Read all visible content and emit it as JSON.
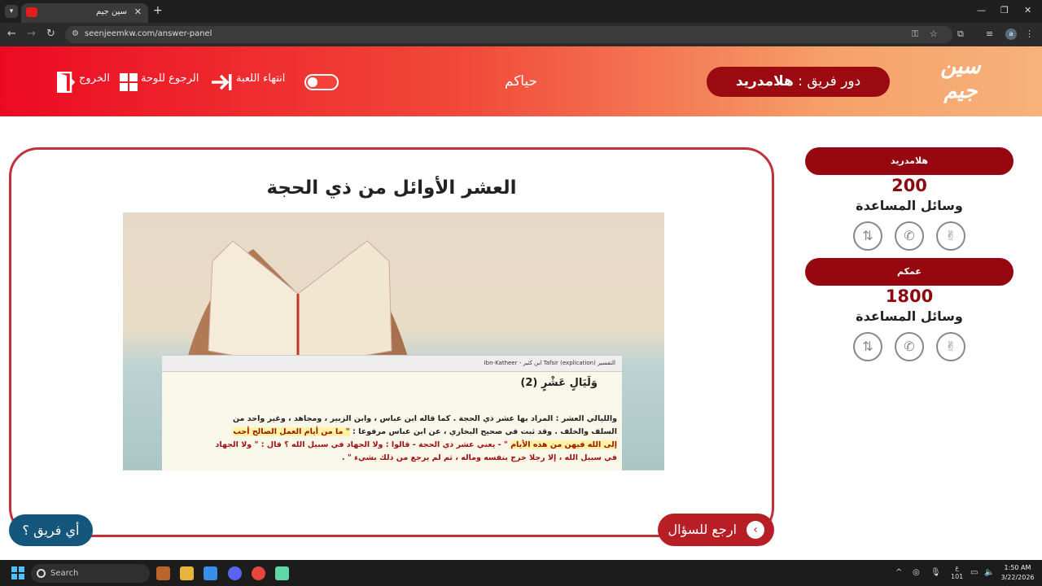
{
  "browser": {
    "tab_title": "سين جيم",
    "url": "seenjeemkw.com/answer-panel",
    "profile_initial": "a"
  },
  "header": {
    "logo_line1": "سين",
    "logo_line2": "جيم",
    "team_turn_label": "دور فريق : ",
    "team_turn_name": "هلامدريد",
    "greeting": "حياكم",
    "end_game": "انتهاء اللعبة",
    "back_to_board": "الرجوع للوحة",
    "exit": "الخروج"
  },
  "teams": [
    {
      "name": "هلامدريد",
      "score": "200",
      "aids_label": "وسائل المساعدة"
    },
    {
      "name": "عمكم",
      "score": "1800",
      "aids_label": "وسائل المساعدة"
    }
  ],
  "question": {
    "title": "العشر الأوائل من ذي الحجة",
    "tafsir_bar": "التفسير Tafsir (explication) ابن كثير - Ibn-Katheer",
    "tafsir_heading": "وَلَيَالٍ عَشْرٍ (2)",
    "tafsir_line1": "والليالي العشر : المراد بها عشر ذي الحجة . كما قاله ابن عباس ، وابن الزبير ، ومجاهد ، وغير واحد من",
    "tafsir_line2a": "السلف والخلف . وقد ثبت في صحيح البخاري ، عن ابن عباس مرفوعا : ",
    "tafsir_line2b": "\" ما من أيام العمل الصالح أحب",
    "tafsir_line3a": "إلى الله فيهن من هذه الأيام",
    "tafsir_line3b": " \" - يعني عشر ذي الحجة - قالوا : ولا الجهاد في سبيل الله ؟ قال : \" ولا الجهاد",
    "tafsir_line4": "في سبيل الله ، إلا رجلا خرج بنفسه وماله ، ثم لم يرجع من ذلك بشيء \" ."
  },
  "buttons": {
    "back_to_question": "ارجع للسؤال",
    "which_team": "أي فريق ؟"
  },
  "taskbar": {
    "search_placeholder": "Search",
    "time": "1:50 AM",
    "date": "3/22/2026",
    "lang": "ع",
    "lang_sub": "101"
  }
}
